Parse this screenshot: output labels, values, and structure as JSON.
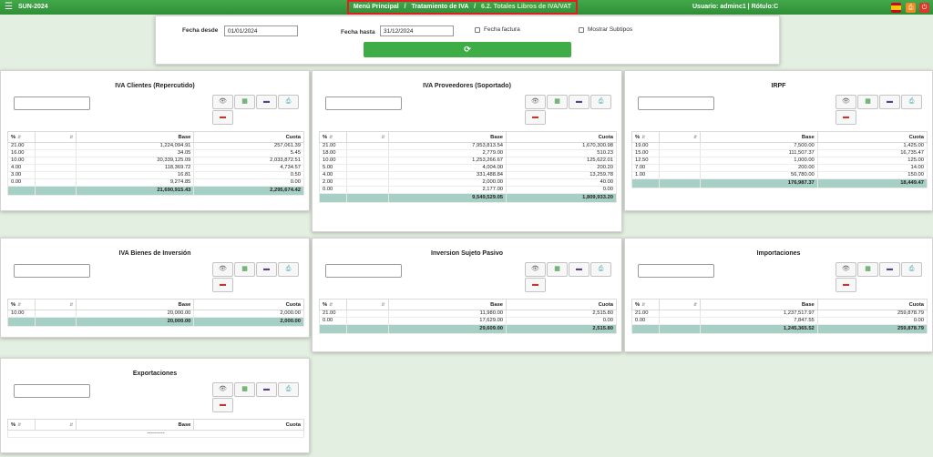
{
  "app": {
    "title": "SUN-2024",
    "menu_icon": "hamburger-menu-icon"
  },
  "breadcrumb": {
    "items": [
      "Menú Principal",
      "Tratamiento de IVA",
      "6.2. Totales Libros de IVA/VAT"
    ],
    "separator": "/"
  },
  "user": {
    "text": "Usuario: adminc1 | Rótulo:C"
  },
  "header_icons": {
    "flag": "spain-flag-icon",
    "print": "print-icon",
    "power": "power-icon"
  },
  "filters": {
    "fecha_desde_label": "Fecha desde",
    "fecha_desde_value": "01/01/2024",
    "fecha_hasta_label": "Fecha hasta",
    "fecha_hasta_value": "31/12/2024",
    "fecha_factura_label": "Fecha factura",
    "mostrar_subtipos_label": "Mostrar Subtipos",
    "refresh_glyph": "⟳"
  },
  "table_headers": {
    "pct": "%",
    "base": "Base",
    "cuota": "Cuota"
  },
  "buttons": {
    "view": "👁",
    "excel": "▦",
    "pdf": "▬",
    "print": "⎙",
    "close": "▬"
  },
  "colors": {
    "topbar": "#3a9e41",
    "accent_green": "#3fad46",
    "total_row": "#a6d0c6",
    "breadcrumb_border": "#e02020"
  },
  "cards": {
    "iva_clientes": {
      "title": "IVA Clientes (Repercutido)",
      "rows": [
        {
          "pct": "21.00",
          "base": "1,224,094.91",
          "cuota": "257,061.39"
        },
        {
          "pct": "16.00",
          "base": "34.05",
          "cuota": "5.45"
        },
        {
          "pct": "10.00",
          "base": "20,339,125.09",
          "cuota": "2,033,872.51"
        },
        {
          "pct": "4.00",
          "base": "118,369.72",
          "cuota": "4,734.57"
        },
        {
          "pct": "3.00",
          "base": "16.81",
          "cuota": "0.50"
        },
        {
          "pct": "0.00",
          "base": "9,274.85",
          "cuota": "0.00"
        }
      ],
      "total": {
        "base": "21,690,915.43",
        "cuota": "2,295,674.42"
      }
    },
    "iva_proveedores": {
      "title": "IVA Proveedores (Soportado)",
      "rows": [
        {
          "pct": "21.00",
          "base": "7,953,813.54",
          "cuota": "1,670,300.98"
        },
        {
          "pct": "18.00",
          "base": "2,779.00",
          "cuota": "510.23"
        },
        {
          "pct": "10.00",
          "base": "1,253,266.67",
          "cuota": "125,622.01"
        },
        {
          "pct": "5.00",
          "base": "4,004.00",
          "cuota": "200.20"
        },
        {
          "pct": "4.00",
          "base": "331,488.84",
          "cuota": "13,259.78"
        },
        {
          "pct": "2.00",
          "base": "2,000.00",
          "cuota": "40.00"
        },
        {
          "pct": "0.00",
          "base": "2,177.00",
          "cuota": "0.00"
        }
      ],
      "total": {
        "base": "9,549,529.05",
        "cuota": "1,809,933.20"
      }
    },
    "irpf": {
      "title": "IRPF",
      "rows": [
        {
          "pct": "19.00",
          "base": "7,500.00",
          "cuota": "1,425.00"
        },
        {
          "pct": "15.00",
          "base": "111,507.37",
          "cuota": "16,735.47"
        },
        {
          "pct": "12.50",
          "base": "1,000.00",
          "cuota": "125.00"
        },
        {
          "pct": "7.00",
          "base": "200.00",
          "cuota": "14.00"
        },
        {
          "pct": "1.00",
          "base": "56,780.00",
          "cuota": "150.00"
        }
      ],
      "total": {
        "base": "176,987.37",
        "cuota": "18,449.47"
      }
    },
    "bienes_inversion": {
      "title": "IVA Bienes de Inversión",
      "rows": [
        {
          "pct": "10.00",
          "base": "20,000.00",
          "cuota": "2,000.00"
        }
      ],
      "total": {
        "base": "20,000.00",
        "cuota": "2,000.00"
      }
    },
    "sujeto_pasivo": {
      "title": "Inversion Sujeto Pasivo",
      "rows": [
        {
          "pct": "21.00",
          "base": "11,980.00",
          "cuota": "2,515.80"
        },
        {
          "pct": "0.00",
          "base": "17,629.00",
          "cuota": "0.00"
        }
      ],
      "total": {
        "base": "29,609.00",
        "cuota": "2,515.80"
      }
    },
    "importaciones": {
      "title": "Importaciones",
      "rows": [
        {
          "pct": "21.00",
          "base": "1,237,517.97",
          "cuota": "259,878.79"
        },
        {
          "pct": "0.00",
          "base": "7,847.55",
          "cuota": "0.00"
        }
      ],
      "total": {
        "base": "1,245,365.52",
        "cuota": "259,878.79"
      }
    },
    "exportaciones": {
      "title": "Exportaciones",
      "rows": [],
      "empty_text": "----------"
    }
  }
}
